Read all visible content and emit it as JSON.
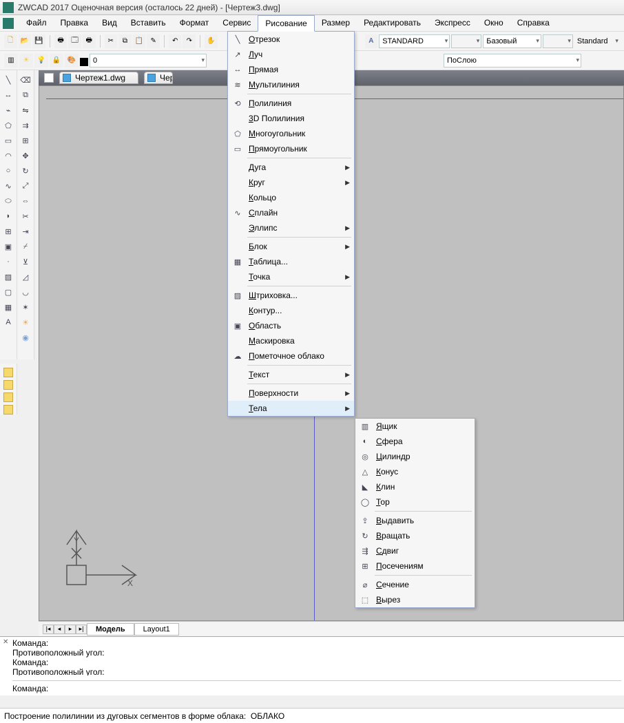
{
  "title": "ZWCAD 2017 Оценочная версия (осталось 22 дней) - [Чертеж3.dwg]",
  "menubar": [
    "Файл",
    "Правка",
    "Вид",
    "Вставить",
    "Формат",
    "Сервис",
    "Рисование",
    "Размер",
    "Редактировать",
    "Экспресс",
    "Окно",
    "Справка"
  ],
  "menubar_open_index": 6,
  "toolbar1": {
    "style_dd": "STANDARD",
    "base_dd": "Базовый",
    "standard_dd": "Standard"
  },
  "toolbar2": {
    "layer_dd": "0",
    "bylayer_dd": "ПоСлою"
  },
  "tabs": [
    "Чертеж1.dwg",
    "Черт"
  ],
  "model_tabs": {
    "nav": [
      "|◂",
      "◂",
      "▸",
      "▸|"
    ],
    "active": "Модель",
    "other": "Layout1"
  },
  "command_history": [
    "Команда:",
    "Противоположный угол:",
    "Команда:",
    "Противоположный угол:"
  ],
  "command_prompt": "Команда:",
  "status": {
    "text": "Построение полилинии из дуговых сегментов в форме облака:",
    "cmd": "ОБЛАКО"
  },
  "draw_menu": [
    {
      "icon": "╲",
      "label": "Отрезок"
    },
    {
      "icon": "↗",
      "label": "Луч"
    },
    {
      "icon": "↔",
      "label": "Прямая"
    },
    {
      "icon": "≋",
      "label": "Мультилиния"
    },
    {
      "sep": true
    },
    {
      "icon": "⟲",
      "label": "Полилиния"
    },
    {
      "icon": "",
      "label": "3D Полилиния"
    },
    {
      "icon": "⬠",
      "label": "Многоугольник"
    },
    {
      "icon": "▭",
      "label": "Прямоугольник"
    },
    {
      "sep": true
    },
    {
      "icon": "",
      "label": "Дуга",
      "sub": true
    },
    {
      "icon": "",
      "label": "Круг",
      "sub": true
    },
    {
      "icon": "",
      "label": "Кольцо"
    },
    {
      "icon": "∿",
      "label": "Сплайн"
    },
    {
      "icon": "",
      "label": "Эллипс",
      "sub": true
    },
    {
      "sep": true
    },
    {
      "icon": "",
      "label": "Блок",
      "sub": true
    },
    {
      "icon": "▦",
      "label": "Таблица..."
    },
    {
      "icon": "",
      "label": "Точка",
      "sub": true
    },
    {
      "sep": true
    },
    {
      "icon": "▨",
      "label": "Штриховка..."
    },
    {
      "icon": "",
      "label": "Контур..."
    },
    {
      "icon": "▣",
      "label": "Область"
    },
    {
      "icon": "",
      "label": "Маскировка"
    },
    {
      "icon": "☁",
      "label": "Пометочное облако"
    },
    {
      "sep": true
    },
    {
      "icon": "",
      "label": "Текст",
      "sub": true
    },
    {
      "sep": true
    },
    {
      "icon": "",
      "label": "Поверхности",
      "sub": true
    },
    {
      "icon": "",
      "label": "Тела",
      "sub": true,
      "hl": true
    }
  ],
  "solids_menu": [
    {
      "icon": "▥",
      "label": "Ящик"
    },
    {
      "icon": "◐",
      "label": "Сфера"
    },
    {
      "icon": "◎",
      "label": "Цилиндр"
    },
    {
      "icon": "△",
      "label": "Конус"
    },
    {
      "icon": "◣",
      "label": "Клин"
    },
    {
      "icon": "◯",
      "label": "Тор"
    },
    {
      "sep": true
    },
    {
      "icon": "⇪",
      "label": "Выдавить"
    },
    {
      "icon": "↻",
      "label": "Вращать"
    },
    {
      "icon": "⇶",
      "label": "Сдвиг"
    },
    {
      "icon": "⊞",
      "label": "Посечениям"
    },
    {
      "sep": true
    },
    {
      "icon": "⌀",
      "label": "Сечение"
    },
    {
      "icon": "⬚",
      "label": "Вырез"
    }
  ]
}
